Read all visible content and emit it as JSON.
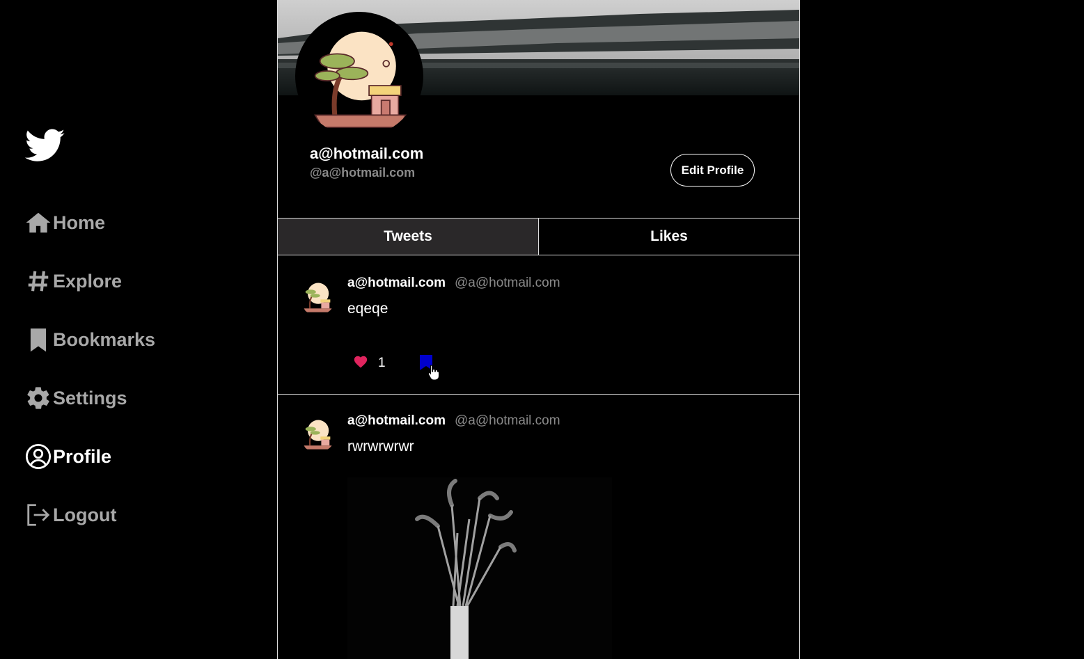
{
  "sidebar": {
    "logo_icon": "twitter-bird-icon",
    "items": [
      {
        "label": "Home",
        "icon": "house-icon",
        "active": false
      },
      {
        "label": "Explore",
        "icon": "hashtag-icon",
        "active": false
      },
      {
        "label": "Bookmarks",
        "icon": "bookmark-icon",
        "active": false
      },
      {
        "label": "Settings",
        "icon": "gear-icon",
        "active": false
      },
      {
        "label": "Profile",
        "icon": "user-circle-icon",
        "active": true
      },
      {
        "label": "Logout",
        "icon": "logout-icon",
        "active": false
      }
    ]
  },
  "profile": {
    "name": "a@hotmail.com",
    "handle": "@a@hotmail.com",
    "edit_label": "Edit Profile"
  },
  "tabs": [
    {
      "label": "Tweets",
      "active": true
    },
    {
      "label": "Likes",
      "active": false
    }
  ],
  "tweets": [
    {
      "name": "a@hotmail.com",
      "handle": "@a@hotmail.com",
      "text": "eqeqe",
      "likes": "1",
      "bookmarked": true
    },
    {
      "name": "a@hotmail.com",
      "handle": "@a@hotmail.com",
      "text": "rwrwrwrwr"
    }
  ],
  "colors": {
    "background": "#000000",
    "like": "#e0245e",
    "bookmark_active": "#0000cc",
    "muted_text": "#a8a8a8",
    "active_tab": "#2a2829"
  }
}
